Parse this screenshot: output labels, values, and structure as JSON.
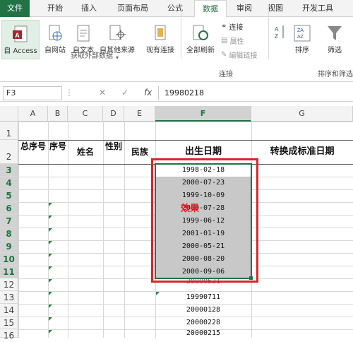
{
  "ribbon_tabs": [
    "文件",
    "开始",
    "插入",
    "页面布局",
    "公式",
    "数据",
    "审阅",
    "视图",
    "开发工具"
  ],
  "active_tab": "数据",
  "ribbon": {
    "get_external": {
      "buttons": [
        "自 Access",
        "自网站",
        "自文本",
        "自其他来源",
        "现有连接"
      ],
      "group_label": "获取外部数据"
    },
    "connections": {
      "refresh_all": "全部刷新",
      "small": [
        "连接",
        "属性",
        "编辑链接"
      ],
      "group_label": "连接"
    },
    "sort_filter": {
      "sort": "排序",
      "filter": "筛选",
      "group_label": "排序和筛选"
    }
  },
  "formula_bar": {
    "name_box": "F3",
    "cancel": "✕",
    "enter": "✓",
    "fx": "fx",
    "value": "19980218"
  },
  "columns": [
    "A",
    "B",
    "C",
    "D",
    "E",
    "F",
    "G"
  ],
  "active_column": "F",
  "rows": [
    "1",
    "2",
    "3",
    "4",
    "5",
    "6",
    "7",
    "8",
    "9",
    "10",
    "11",
    "12",
    "13",
    "14",
    "15",
    "16"
  ],
  "header_row": {
    "a": "总序号",
    "b": "序号",
    "c": "姓名",
    "d": "性别",
    "e": "民族",
    "f": "出生日期",
    "g": "转换成标准日期"
  },
  "converted_dates": [
    "1998-02-18",
    "2000-07-23",
    "1999-10-09",
    "2000-07-28",
    "1999-06-12",
    "2001-01-19",
    "2000-05-21",
    "2000-08-20",
    "2000-09-06"
  ],
  "raw_dates": [
    "20000521",
    "19990711",
    "20000128",
    "20000228",
    "20000215"
  ],
  "overlay_label": "效果",
  "accent_color": "#217346",
  "highlight_color": "#d9262b"
}
